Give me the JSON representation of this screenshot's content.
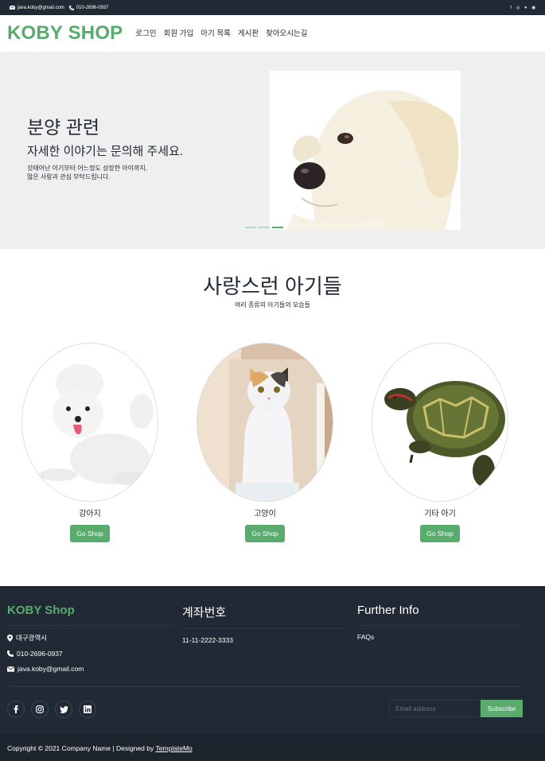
{
  "topbar": {
    "email": "java.koby@gmail.com",
    "phone": "010-2696-0937",
    "social_icons": [
      "facebook-icon",
      "instagram-icon",
      "twitter-icon",
      "linkedin-icon"
    ]
  },
  "nav": {
    "brand": "KOBY SHOP",
    "items": [
      {
        "label": "로그인"
      },
      {
        "label": "회원 가입"
      },
      {
        "label": "아기 목록"
      },
      {
        "label": "게시판"
      },
      {
        "label": "찾아오시는길"
      }
    ]
  },
  "hero": {
    "title": "분양 관련",
    "subtitle": "자세한 이야기는 문의해 주세요.",
    "text_line1": "갓태어난 아기부터 어느정도 성장한 아이까지,",
    "text_line2": "많은 사랑과 관심 부탁드립니다.",
    "slide_index": 3,
    "slide_count": 3
  },
  "categories": {
    "title": "사랑스런 아기들",
    "subtitle": "여러 종류의 아기들의 모습들",
    "items": [
      {
        "name": "강아지",
        "button": "Go Shop"
      },
      {
        "name": "고양이",
        "button": "Go Shop"
      },
      {
        "name": "기타 아기",
        "button": "Go Shop"
      }
    ]
  },
  "footer": {
    "col1": {
      "title": "KOBY Shop",
      "address": "대구광역시",
      "phone": "010-2696-0937",
      "email": "java.koby@gmail.com"
    },
    "col2": {
      "title": "계좌번호",
      "account": "11-11-2222-3333"
    },
    "col3": {
      "title": "Further Info",
      "link": "FAQs"
    },
    "subscribe": {
      "placeholder": "Email address",
      "button": "Subscribe"
    },
    "social_icons": [
      "facebook-icon",
      "instagram-icon",
      "twitter-icon",
      "linkedin-icon"
    ],
    "copyright": "Copyright © 2021 Company Name | Designed by",
    "designer": "TemplateMo"
  },
  "colors": {
    "accent": "#59ab6e",
    "dark": "#212934"
  }
}
